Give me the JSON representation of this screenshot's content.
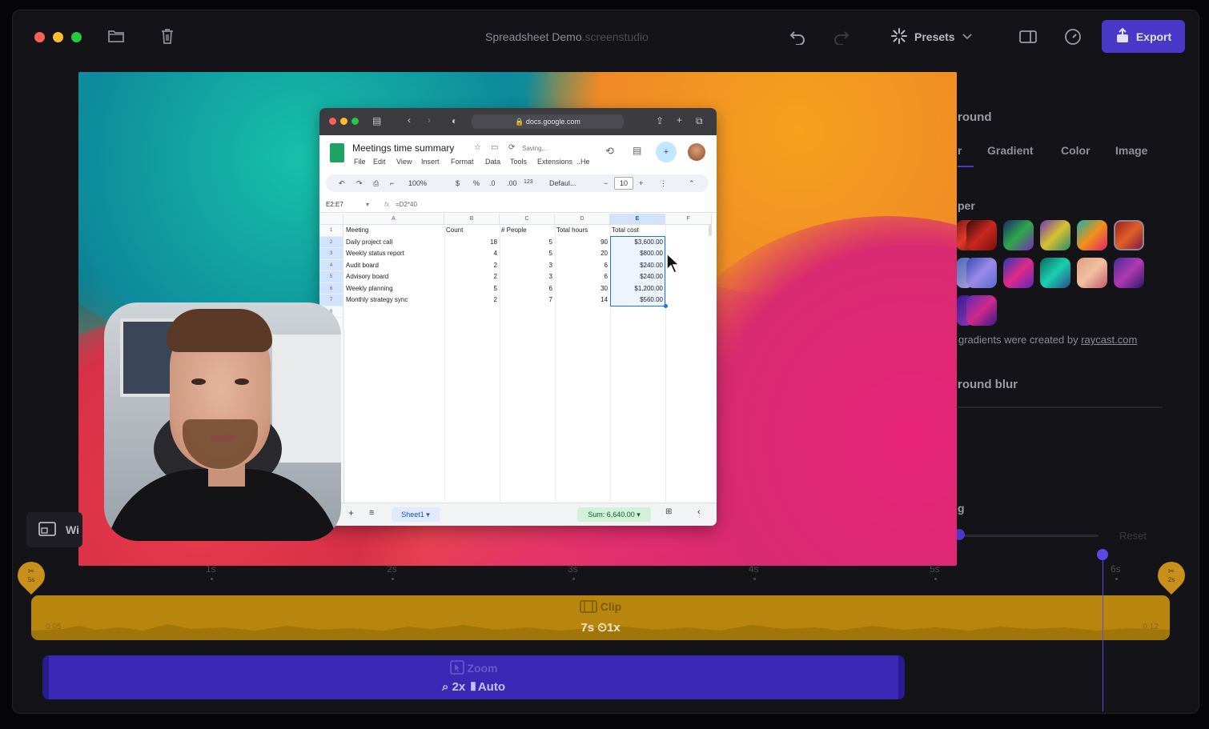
{
  "window": {
    "title": "Spreadsheet Demo",
    "title_suffix": ".screenstudio",
    "traffic_lights": [
      "#ff5f57",
      "#febc2e",
      "#28c840"
    ]
  },
  "toolbar": {
    "presets_label": "Presets",
    "export_label": "Export",
    "accent": "#4a38c8"
  },
  "background_panel": {
    "section_title": "round",
    "tabs": [
      "r",
      "Gradient",
      "Color",
      "Image"
    ],
    "wallpaper_label": "per",
    "credit_text": "gradients were created by",
    "credit_link": "raycast.com",
    "blur_label": "round blur",
    "slider_label": "g",
    "reset_label": "Reset"
  },
  "browser": {
    "url": "docs.google.com",
    "doc_title": "Meetings time summary",
    "saving": "Saving...",
    "menu": [
      "File",
      "Edit",
      "View",
      "Insert",
      "Format",
      "Data",
      "Tools",
      "Extensions",
      "He"
    ],
    "zoom": "100%",
    "font": "Defaul...",
    "font_size": "10",
    "cell_ref": "E2:E7",
    "formula": "=D2*40",
    "columns": [
      "A",
      "B",
      "C",
      "D",
      "E",
      "F"
    ],
    "header_row": [
      "Meeting",
      "Count",
      "# People",
      "Total hours",
      "Total cost"
    ],
    "rows": [
      [
        "Daily project call",
        "18",
        "5",
        "90",
        "$3,600.00"
      ],
      [
        "Weekly status report",
        "4",
        "5",
        "20",
        "$800.00"
      ],
      [
        "Audit board",
        "2",
        "3",
        "6",
        "$240.00"
      ],
      [
        "Advisory board",
        "2",
        "3",
        "6",
        "$240.00"
      ],
      [
        "Weekly planning",
        "5",
        "6",
        "30",
        "$1,200.00"
      ],
      [
        "Monthly strategy sync",
        "2",
        "7",
        "14",
        "$560.00"
      ]
    ],
    "row_numbers": [
      "1",
      "2",
      "3",
      "4",
      "5",
      "6",
      "7",
      "8",
      "9"
    ],
    "sheet_tab": "Sheet1",
    "sum": "Sum: 6,640.00"
  },
  "layout_toggle": {
    "label": "Wi"
  },
  "timeline": {
    "ticks": [
      "1s",
      "2s",
      "3s",
      "4s",
      "5s",
      "6s"
    ],
    "start_pin": "5s",
    "end_pin": "2s",
    "clip_label": "Clip",
    "clip_duration": "7s",
    "clip_speed": "1x",
    "clip_start_time": "0:05",
    "clip_end_time": "0:12",
    "zoom_label": "Zoom",
    "zoom_level": "2x",
    "zoom_mode": "Auto"
  }
}
